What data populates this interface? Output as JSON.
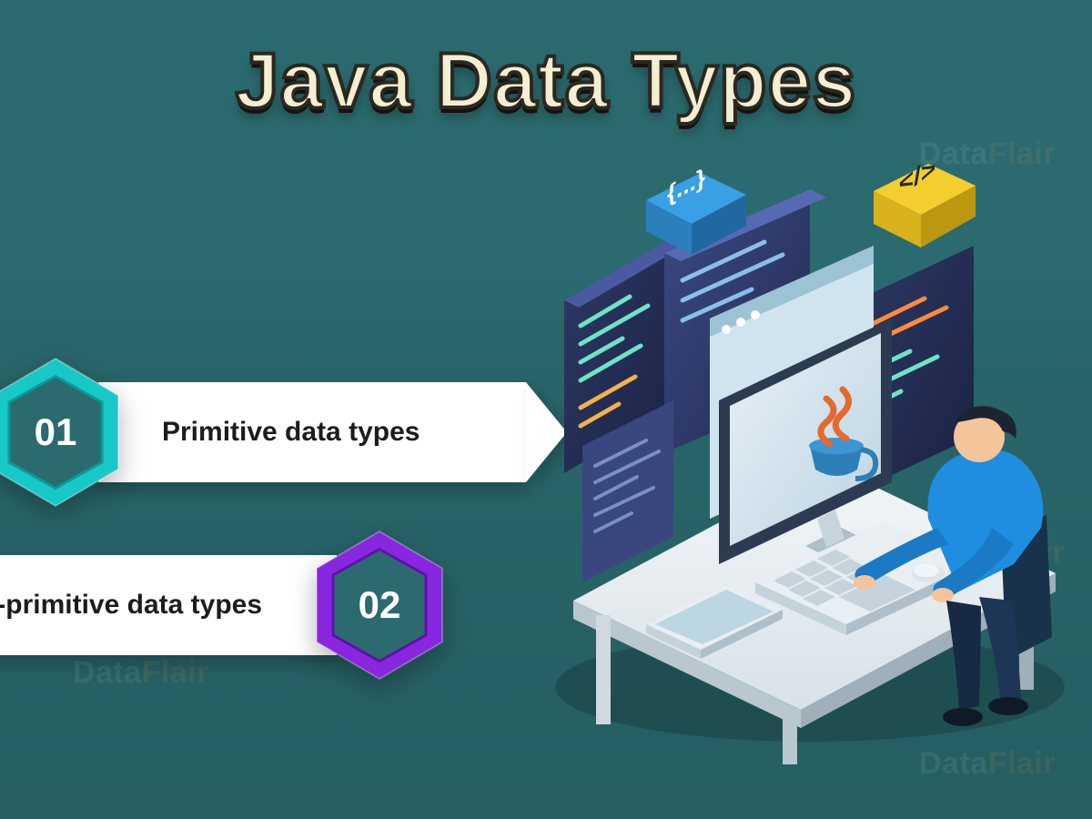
{
  "title": "Java Data Types",
  "items": [
    {
      "number": "01",
      "label": "Primitive data types",
      "color": "#17c8c6",
      "colorDark": "#0a9a98"
    },
    {
      "number": "02",
      "label": "Non-primitive data types",
      "color": "#8826e0",
      "colorDark": "#5d12a8"
    }
  ],
  "icons": {
    "braces": "{...}",
    "code": "</>"
  },
  "watermark": {
    "left": "Data",
    "right": "Flair"
  }
}
